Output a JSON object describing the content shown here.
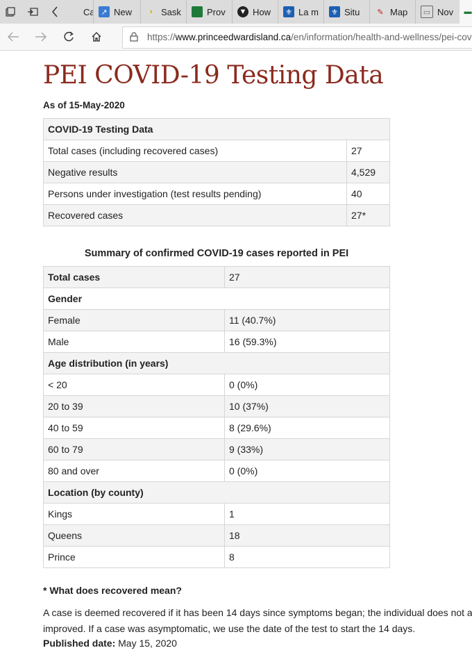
{
  "browser": {
    "tabs": [
      {
        "label": "Case",
        "icon": "case-icon"
      },
      {
        "label": "New",
        "icon": "chart-icon"
      },
      {
        "label": "Sask",
        "icon": "banana-icon"
      },
      {
        "label": "Prov",
        "icon": "flag-icon"
      },
      {
        "label": "How",
        "icon": "shield-icon"
      },
      {
        "label": "La m",
        "icon": "fleur-de-lis-icon"
      },
      {
        "label": "Situ",
        "icon": "fleur-de-lis-icon"
      },
      {
        "label": "Map",
        "icon": "pen-icon"
      },
      {
        "label": "Nov",
        "icon": "image-icon"
      }
    ],
    "url_prefix": "https://",
    "url_domain": "www.princeedwardisland.ca",
    "url_path": "/en/information/health-and-wellness/pei-covid"
  },
  "page": {
    "title": "PEI COVID-19 Testing Data",
    "as_of": "As of 15-May-2020",
    "testing_table": {
      "header": "COVID-19 Testing Data",
      "rows": [
        {
          "label": "Total cases (including recovered cases)",
          "value": "27"
        },
        {
          "label": "Negative results",
          "value": "4,529"
        },
        {
          "label": "Persons under investigation (test results pending)",
          "value": "40"
        },
        {
          "label": "Recovered cases",
          "value": "27*"
        }
      ]
    },
    "summary_caption": "Summary of confirmed COVID-19 cases reported in PEI",
    "summary": {
      "total_label": "Total cases",
      "total_value": "27",
      "gender_header": "Gender",
      "female_label": "Female",
      "female_value": "11 (40.7%)",
      "male_label": "Male",
      "male_value": "16 (59.3%)",
      "age_header": "Age distribution (in years)",
      "age_rows": [
        {
          "label": "< 20",
          "value": "0 (0%)"
        },
        {
          "label": "20 to 39",
          "value": "10 (37%)"
        },
        {
          "label": "40 to 59",
          "value": "8 (29.6%)"
        },
        {
          "label": "60 to 79",
          "value": "9 (33%)"
        },
        {
          "label": "80 and over",
          "value": "0 (0%)"
        }
      ],
      "location_header": "Location (by county)",
      "location_rows": [
        {
          "label": "Kings",
          "value": "1"
        },
        {
          "label": "Queens",
          "value": "18"
        },
        {
          "label": "Prince",
          "value": "8"
        }
      ]
    },
    "recovered_note_heading": "* What does recovered mean?",
    "recovered_para_line1": "A case is deemed recovered if it has been 14 days since symptoms began; the individual does not a",
    "recovered_para_line2": "improved. If a case was asymptomatic, we use the date of the test to start the 14 days.",
    "published_label": "Published date:",
    "published_value": "May 15, 2020"
  }
}
